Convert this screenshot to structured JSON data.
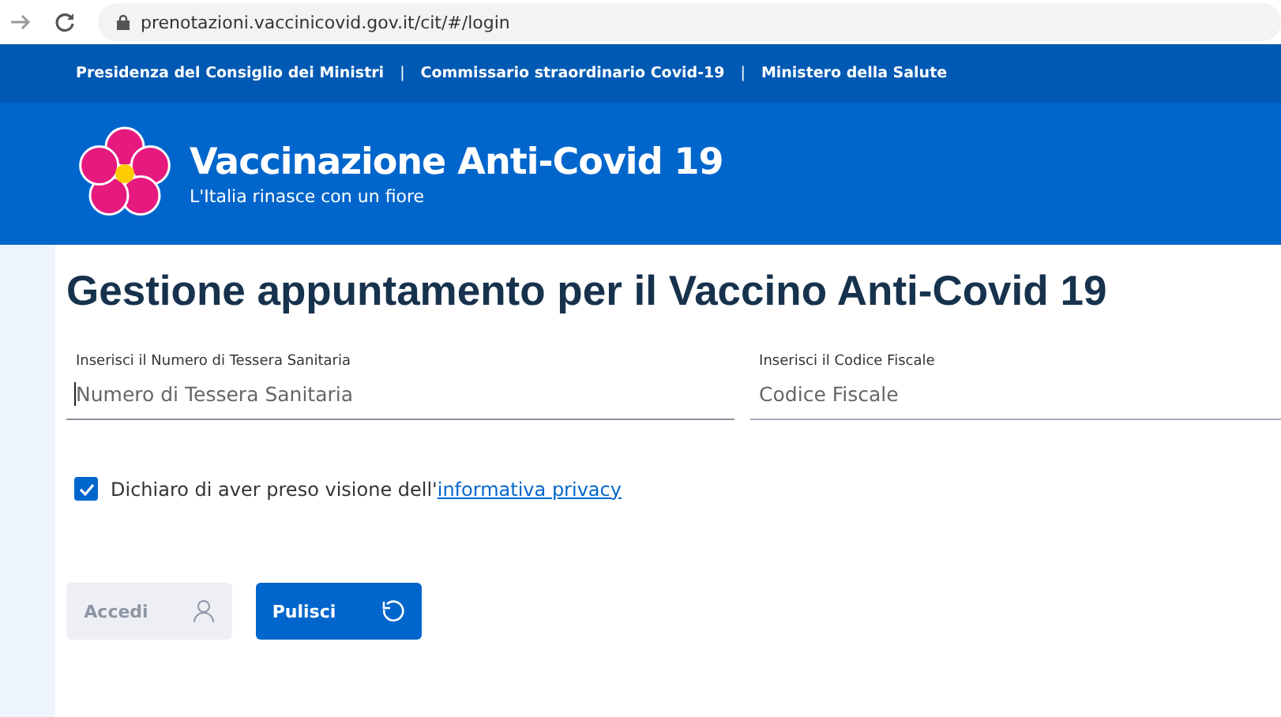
{
  "browser": {
    "url": "prenotazioni.vaccinicovid.gov.it/cit/#/login"
  },
  "top_links": [
    "Presidenza del Consiglio dei Ministri",
    "Commissario straordinario Covid-19",
    "Ministero della Salute"
  ],
  "separators": [
    "|",
    "|"
  ],
  "header": {
    "title": "Vaccinazione Anti-Covid 19",
    "subtitle": "L'Italia rinasce con un fiore"
  },
  "page_title": "Gestione appuntamento per il Vaccino Anti-Covid 19",
  "fields": [
    {
      "label": "Inserisci il Numero di Tessera Sanitaria",
      "placeholder": "Numero di Tessera Sanitaria",
      "focused": true
    },
    {
      "label": "Inserisci il Codice Fiscale",
      "placeholder": "Codice Fiscale",
      "focused": false
    }
  ],
  "privacy": {
    "checked": true,
    "text": "Dichiaro di aver preso visione dell'",
    "link": "informativa privacy"
  },
  "buttons": [
    {
      "label": "Accedi",
      "kind": "login",
      "disabled": true
    },
    {
      "label": "Pulisci",
      "kind": "reset",
      "disabled": false
    }
  ]
}
